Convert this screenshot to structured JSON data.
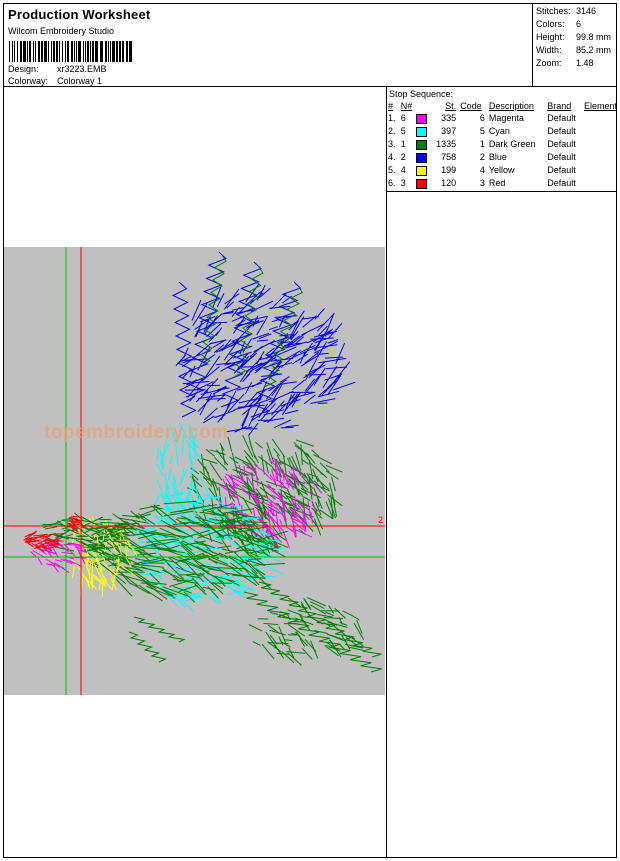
{
  "header": {
    "title": "Production Worksheet",
    "software": "Wilcom Embroidery Studio",
    "design_label": "Design:",
    "design_value": "xr3223.EMB",
    "colorway_label": "Colorway:",
    "colorway_value": "Colorway 1"
  },
  "stats": [
    {
      "label": "Stitches:",
      "value": "3146"
    },
    {
      "label": "Colors:",
      "value": "6"
    },
    {
      "label": "Height:",
      "value": "99.8 mm"
    },
    {
      "label": "Width:",
      "value": "85.2 mm"
    },
    {
      "label": "Zoom:",
      "value": "1.48"
    }
  ],
  "stop_sequence": {
    "title": "Stop Sequence:",
    "columns": [
      "#",
      "N#",
      "St.",
      "Code",
      "Description",
      "Brand",
      "Element"
    ],
    "rows": [
      {
        "idx": "1.",
        "n": "6",
        "color": "#ff00ff",
        "st": "335",
        "code": "6",
        "desc": "Magenta",
        "brand": "Default"
      },
      {
        "idx": "2.",
        "n": "5",
        "color": "#00ffff",
        "st": "397",
        "code": "5",
        "desc": "Cyan",
        "brand": "Default"
      },
      {
        "idx": "3.",
        "n": "1",
        "color": "#008000",
        "st": "1335",
        "code": "1",
        "desc": "Dark Green",
        "brand": "Default"
      },
      {
        "idx": "4.",
        "n": "2",
        "color": "#0000ff",
        "st": "758",
        "code": "2",
        "desc": "Blue",
        "brand": "Default"
      },
      {
        "idx": "5.",
        "n": "4",
        "color": "#ffff00",
        "st": "199",
        "code": "4",
        "desc": "Yellow",
        "brand": "Default"
      },
      {
        "idx": "6.",
        "n": "3",
        "color": "#ff0000",
        "st": "120",
        "code": "3",
        "desc": "Red",
        "brand": "Default"
      }
    ]
  },
  "preview": {
    "watermark": "topembroidery.com",
    "marker_label": "2"
  }
}
